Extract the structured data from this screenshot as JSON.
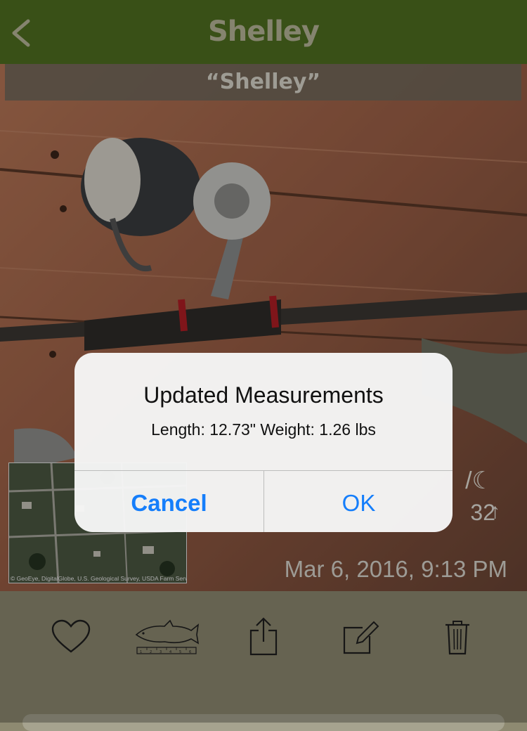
{
  "nav": {
    "title": "Shelley",
    "back_icon": "chevron-left-icon"
  },
  "photo": {
    "caption": "“Shelley”",
    "map_credit": "© GeoEye, DigitalGlobe, U.S. Geological Survey, USDA Farm Service Agency",
    "stat_partial": "32",
    "date": "Mar 6, 2016, 9:13 PM"
  },
  "toolbar": {
    "icons": [
      "heart-icon",
      "fish-measure-icon",
      "share-icon",
      "edit-icon",
      "trash-icon"
    ],
    "ruler_ticks": [
      "1",
      "2",
      "3",
      "4",
      "5",
      "6"
    ]
  },
  "alert": {
    "title": "Updated Measurements",
    "message": "Length: 12.73\" Weight: 1.26 lbs",
    "cancel_label": "Cancel",
    "ok_label": "OK"
  },
  "colors": {
    "nav_bg": "#4f6f20",
    "toolbar_bg": "#8e8a71",
    "accent": "#157efb"
  }
}
